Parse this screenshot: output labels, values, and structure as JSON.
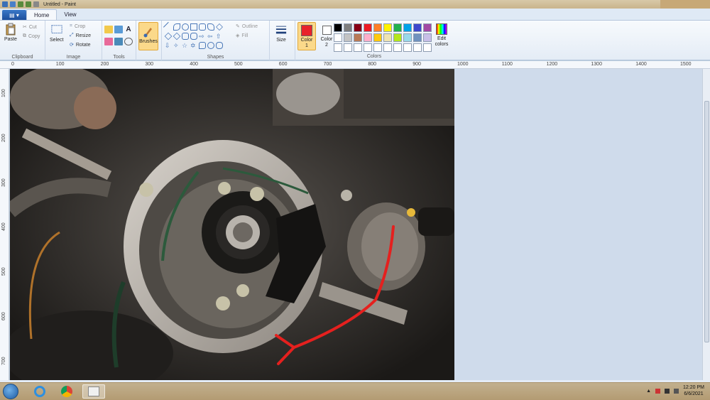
{
  "window": {
    "title": "Untitled - Paint"
  },
  "tabs": {
    "app_menu": "▤ ▾",
    "home": "Home",
    "view": "View"
  },
  "clipboard": {
    "label": "Clipboard",
    "paste": "Paste",
    "cut": "Cut",
    "copy": "Copy"
  },
  "image": {
    "label": "Image",
    "select": "Select",
    "crop": "Crop",
    "resize": "Resize",
    "rotate": "Rotate"
  },
  "tools": {
    "label": "Tools"
  },
  "brushes": {
    "label": "Brushes"
  },
  "shapes": {
    "label": "Shapes",
    "outline": "Outline",
    "fill": "Fill"
  },
  "size": {
    "label": "Size"
  },
  "colors": {
    "label": "Colors",
    "color1_label": "Color 1",
    "color2_label": "Color 2",
    "edit_label": "Edit colors",
    "color1_value": "#e8232a",
    "color2_value": "#ffffff",
    "swatches": [
      "#000000",
      "#7f7f7f",
      "#880015",
      "#ed1c24",
      "#ff7f27",
      "#fff200",
      "#22b14c",
      "#00a2e8",
      "#3f48cc",
      "#a349a4",
      "#ffffff",
      "#c3c3c3",
      "#b97a57",
      "#ffaec9",
      "#ffc90e",
      "#efe4b0",
      "#b5e61d",
      "#99d9ea",
      "#7092be",
      "#c8bfe7",
      "#ffffff",
      "#ffffff",
      "#ffffff",
      "#ffffff",
      "#ffffff",
      "#ffffff",
      "#ffffff",
      "#ffffff",
      "#ffffff",
      "#ffffff"
    ]
  },
  "ruler": {
    "h_ticks": [
      "0",
      "100",
      "200",
      "300",
      "400",
      "500",
      "600",
      "700",
      "800",
      "900",
      "1000",
      "1100",
      "1200",
      "1300",
      "1400",
      "1500"
    ],
    "v_ticks": [
      "100",
      "200",
      "300",
      "400",
      "500",
      "600",
      "700"
    ]
  },
  "taskbar": {
    "time": "12:20 PM",
    "date": "6/6/2021"
  }
}
